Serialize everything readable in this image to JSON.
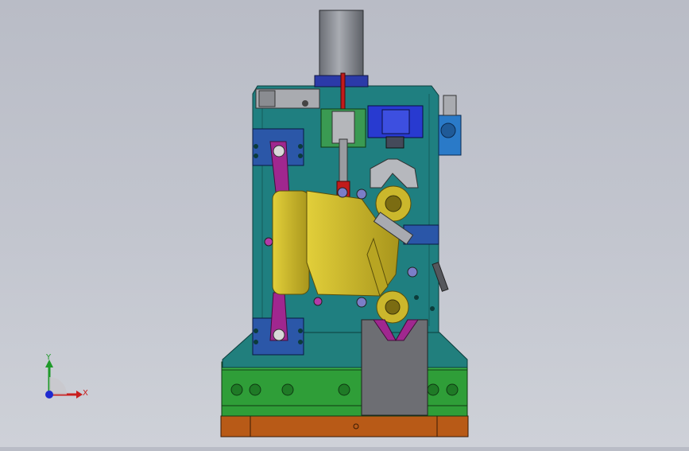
{
  "viewport": {
    "background": "#c2c5ce"
  },
  "triad": {
    "x_label": "X",
    "y_label": "Y",
    "x_color": "#c81e1e",
    "y_color": "#1f9a2a",
    "z_color": "#1e2ad0"
  },
  "colors": {
    "plate": "#1f7f80",
    "plate_dark": "#14585a",
    "base_green": "#2fa33a",
    "base_wood": "#b35a1a",
    "part": "#c9b62a",
    "part_dark": "#6f6210",
    "motor": "#8b8e95",
    "magenta": "#a02a92",
    "clamp_blue": "#2a36b8",
    "v_block": "#6e6f74"
  }
}
